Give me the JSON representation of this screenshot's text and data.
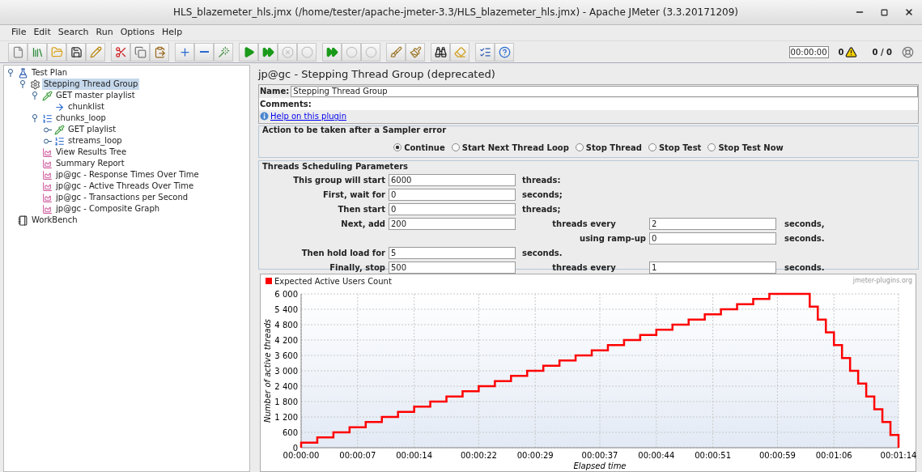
{
  "window": {
    "title": "HLS_blazemeter_hls.jmx (/home/tester/apache-jmeter-3.3/HLS_blazemeter_hls.jmx) - Apache JMeter (3.3.20171209)"
  },
  "menu": [
    {
      "label": "File"
    },
    {
      "label": "Edit"
    },
    {
      "label": "Search"
    },
    {
      "label": "Run"
    },
    {
      "label": "Options"
    },
    {
      "label": "Help"
    }
  ],
  "toolbar": [
    [
      {
        "kind": "new",
        "disabled": false
      },
      {
        "kind": "templates",
        "disabled": false
      },
      {
        "kind": "open",
        "disabled": false
      },
      {
        "kind": "save",
        "disabled": false
      },
      {
        "kind": "save_as",
        "disabled": false
      }
    ],
    [
      {
        "kind": "cut",
        "disabled": false
      },
      {
        "kind": "copy",
        "disabled": false
      },
      {
        "kind": "paste",
        "disabled": false
      }
    ],
    [
      {
        "kind": "expand",
        "disabled": false
      },
      {
        "kind": "collapse",
        "disabled": false
      },
      {
        "kind": "toggle",
        "disabled": false
      }
    ],
    [
      {
        "kind": "start",
        "disabled": false
      },
      {
        "kind": "start_no_pause",
        "disabled": false
      },
      {
        "kind": "stop",
        "disabled": true
      },
      {
        "kind": "shutdown",
        "disabled": true
      }
    ],
    [
      {
        "kind": "remote_start",
        "disabled": false
      },
      {
        "kind": "remote_stop",
        "disabled": true
      },
      {
        "kind": "remote_shutdown",
        "disabled": true
      }
    ],
    [
      {
        "kind": "clear",
        "disabled": false
      },
      {
        "kind": "clear_all",
        "disabled": false
      }
    ],
    [
      {
        "kind": "search",
        "disabled": false
      },
      {
        "kind": "reset_search",
        "disabled": false
      }
    ],
    [
      {
        "kind": "function_helper",
        "disabled": false
      },
      {
        "kind": "help",
        "disabled": false
      }
    ]
  ],
  "status": {
    "timer": "00:00:00",
    "warnings": "0",
    "threads": "0 / 0"
  },
  "tree": [
    {
      "label": "Test Plan",
      "kind": "plan",
      "expanded": true,
      "selected": false,
      "children": [
        {
          "label": "Stepping Thread Group",
          "kind": "thread_group",
          "expanded": true,
          "selected": true,
          "children": [
            {
              "label": "GET master playlist",
              "kind": "sampler",
              "expanded": true,
              "selected": false,
              "children": [
                {
                  "label": "chunklist",
                  "kind": "extractor",
                  "selected": false
                }
              ]
            },
            {
              "label": "chunks_loop",
              "kind": "controller",
              "expanded": true,
              "selected": false,
              "children": [
                {
                  "label": "GET playlist",
                  "kind": "sampler",
                  "expanded": false,
                  "selected": false
                },
                {
                  "label": "streams_loop",
                  "kind": "controller",
                  "expanded": false,
                  "selected": false
                }
              ]
            },
            {
              "label": "View Results Tree",
              "kind": "listener",
              "selected": false
            },
            {
              "label": "Summary Report",
              "kind": "listener",
              "selected": false
            },
            {
              "label": "jp@gc - Response Times Over Time",
              "kind": "listener",
              "selected": false
            },
            {
              "label": "jp@gc - Active Threads Over Time",
              "kind": "listener",
              "selected": false
            },
            {
              "label": "jp@gc - Transactions per Second",
              "kind": "listener",
              "selected": false
            },
            {
              "label": "jp@gc - Composite Graph",
              "kind": "listener",
              "selected": false
            }
          ]
        }
      ]
    },
    {
      "label": "WorkBench",
      "kind": "workbench",
      "selected": false
    }
  ],
  "panel": {
    "title": "jp@gc - Stepping Thread Group (deprecated)",
    "name_label": "Name:",
    "name_value": "Stepping Thread Group",
    "comments_label": "Comments:",
    "help_link": "Help on this plugin"
  },
  "error_action": {
    "title": "Action to be taken after a Sampler error",
    "options": [
      {
        "label": "Continue",
        "selected": true
      },
      {
        "label": "Start Next Thread Loop",
        "selected": false
      },
      {
        "label": "Stop Thread",
        "selected": false
      },
      {
        "label": "Stop Test",
        "selected": false
      },
      {
        "label": "Stop Test Now",
        "selected": false
      }
    ]
  },
  "scheduling": {
    "title": "Threads Scheduling Parameters",
    "rows": [
      {
        "label": "This group will start",
        "value": "6000",
        "unit": "threads:"
      },
      {
        "label": "First, wait for",
        "value": "0",
        "unit": "seconds;"
      },
      {
        "label": "Then start",
        "value": "0",
        "unit": "threads;"
      },
      {
        "label": "Next, add",
        "value": "200",
        "label2": "threads every",
        "value2": "2",
        "unit2": "seconds,"
      },
      {
        "label2": "using ramp-up",
        "value2": "0",
        "unit2": "seconds."
      },
      {
        "label": "Then hold load for",
        "value": "5",
        "unit": "seconds."
      },
      {
        "label": "Finally, stop",
        "value": "500",
        "label2": "threads every",
        "value2": "1",
        "unit2": "seconds."
      }
    ]
  },
  "chart_credit": "jmeter-plugins.org",
  "chart_data": {
    "type": "line",
    "xlabel": "Elapsed time",
    "ylabel": "Number of active threads",
    "grid": true,
    "x": [
      0,
      0,
      2,
      2,
      4,
      4,
      6,
      6,
      8,
      8,
      10,
      10,
      12,
      12,
      14,
      14,
      16,
      16,
      18,
      18,
      20,
      20,
      22,
      22,
      24,
      24,
      26,
      26,
      28,
      28,
      30,
      30,
      32,
      32,
      34,
      34,
      36,
      36,
      38,
      38,
      40,
      40,
      42,
      42,
      44,
      44,
      46,
      46,
      48,
      48,
      50,
      50,
      52,
      52,
      54,
      54,
      56,
      56,
      58,
      58,
      63,
      63,
      64,
      64,
      65,
      65,
      66,
      66,
      67,
      67,
      68,
      68,
      69,
      69,
      70,
      70,
      71,
      71,
      72,
      72,
      73,
      73,
      74,
      74
    ],
    "series": [
      {
        "name": "Expected Active Users Count",
        "color": "#ff0000",
        "values": [
          0,
          200,
          200,
          400,
          400,
          600,
          600,
          800,
          800,
          1000,
          1000,
          1200,
          1200,
          1400,
          1400,
          1600,
          1600,
          1800,
          1800,
          2000,
          2000,
          2200,
          2200,
          2400,
          2400,
          2600,
          2600,
          2800,
          2800,
          3000,
          3000,
          3200,
          3200,
          3400,
          3400,
          3600,
          3600,
          3800,
          3800,
          4000,
          4000,
          4200,
          4200,
          4400,
          4400,
          4600,
          4600,
          4800,
          4800,
          5000,
          5000,
          5200,
          5200,
          5400,
          5400,
          5600,
          5600,
          5800,
          5800,
          6000,
          6000,
          5500,
          5500,
          5000,
          5000,
          4500,
          4500,
          4000,
          4000,
          3500,
          3500,
          3000,
          3000,
          2500,
          2500,
          2000,
          2000,
          1500,
          1500,
          1000,
          1000,
          500,
          500,
          0
        ]
      }
    ],
    "xlim": [
      0,
      74
    ],
    "ylim": [
      0,
      6000
    ],
    "xticks": [
      {
        "value": 0,
        "label": "00:00:00"
      },
      {
        "value": 7,
        "label": "00:00:07"
      },
      {
        "value": 14,
        "label": "00:00:14"
      },
      {
        "value": 22,
        "label": "00:00:22"
      },
      {
        "value": 29,
        "label": "00:00:29"
      },
      {
        "value": 37,
        "label": "00:00:37"
      },
      {
        "value": 44,
        "label": "00:00:44"
      },
      {
        "value": 51,
        "label": "00:00:51"
      },
      {
        "value": 59,
        "label": "00:00:59"
      },
      {
        "value": 66,
        "label": "00:01:06"
      },
      {
        "value": 74,
        "label": "00:01:14"
      }
    ],
    "yticks": [
      {
        "value": 0,
        "label": "0"
      },
      {
        "value": 600,
        "label": "600"
      },
      {
        "value": 1200,
        "label": "1 200"
      },
      {
        "value": 1800,
        "label": "1 800"
      },
      {
        "value": 2400,
        "label": "2 400"
      },
      {
        "value": 3000,
        "label": "3 000"
      },
      {
        "value": 3600,
        "label": "3 600"
      },
      {
        "value": 4200,
        "label": "4 200"
      },
      {
        "value": 4800,
        "label": "4 800"
      },
      {
        "value": 5400,
        "label": "5 400"
      },
      {
        "value": 6000,
        "label": "6 000"
      }
    ]
  }
}
